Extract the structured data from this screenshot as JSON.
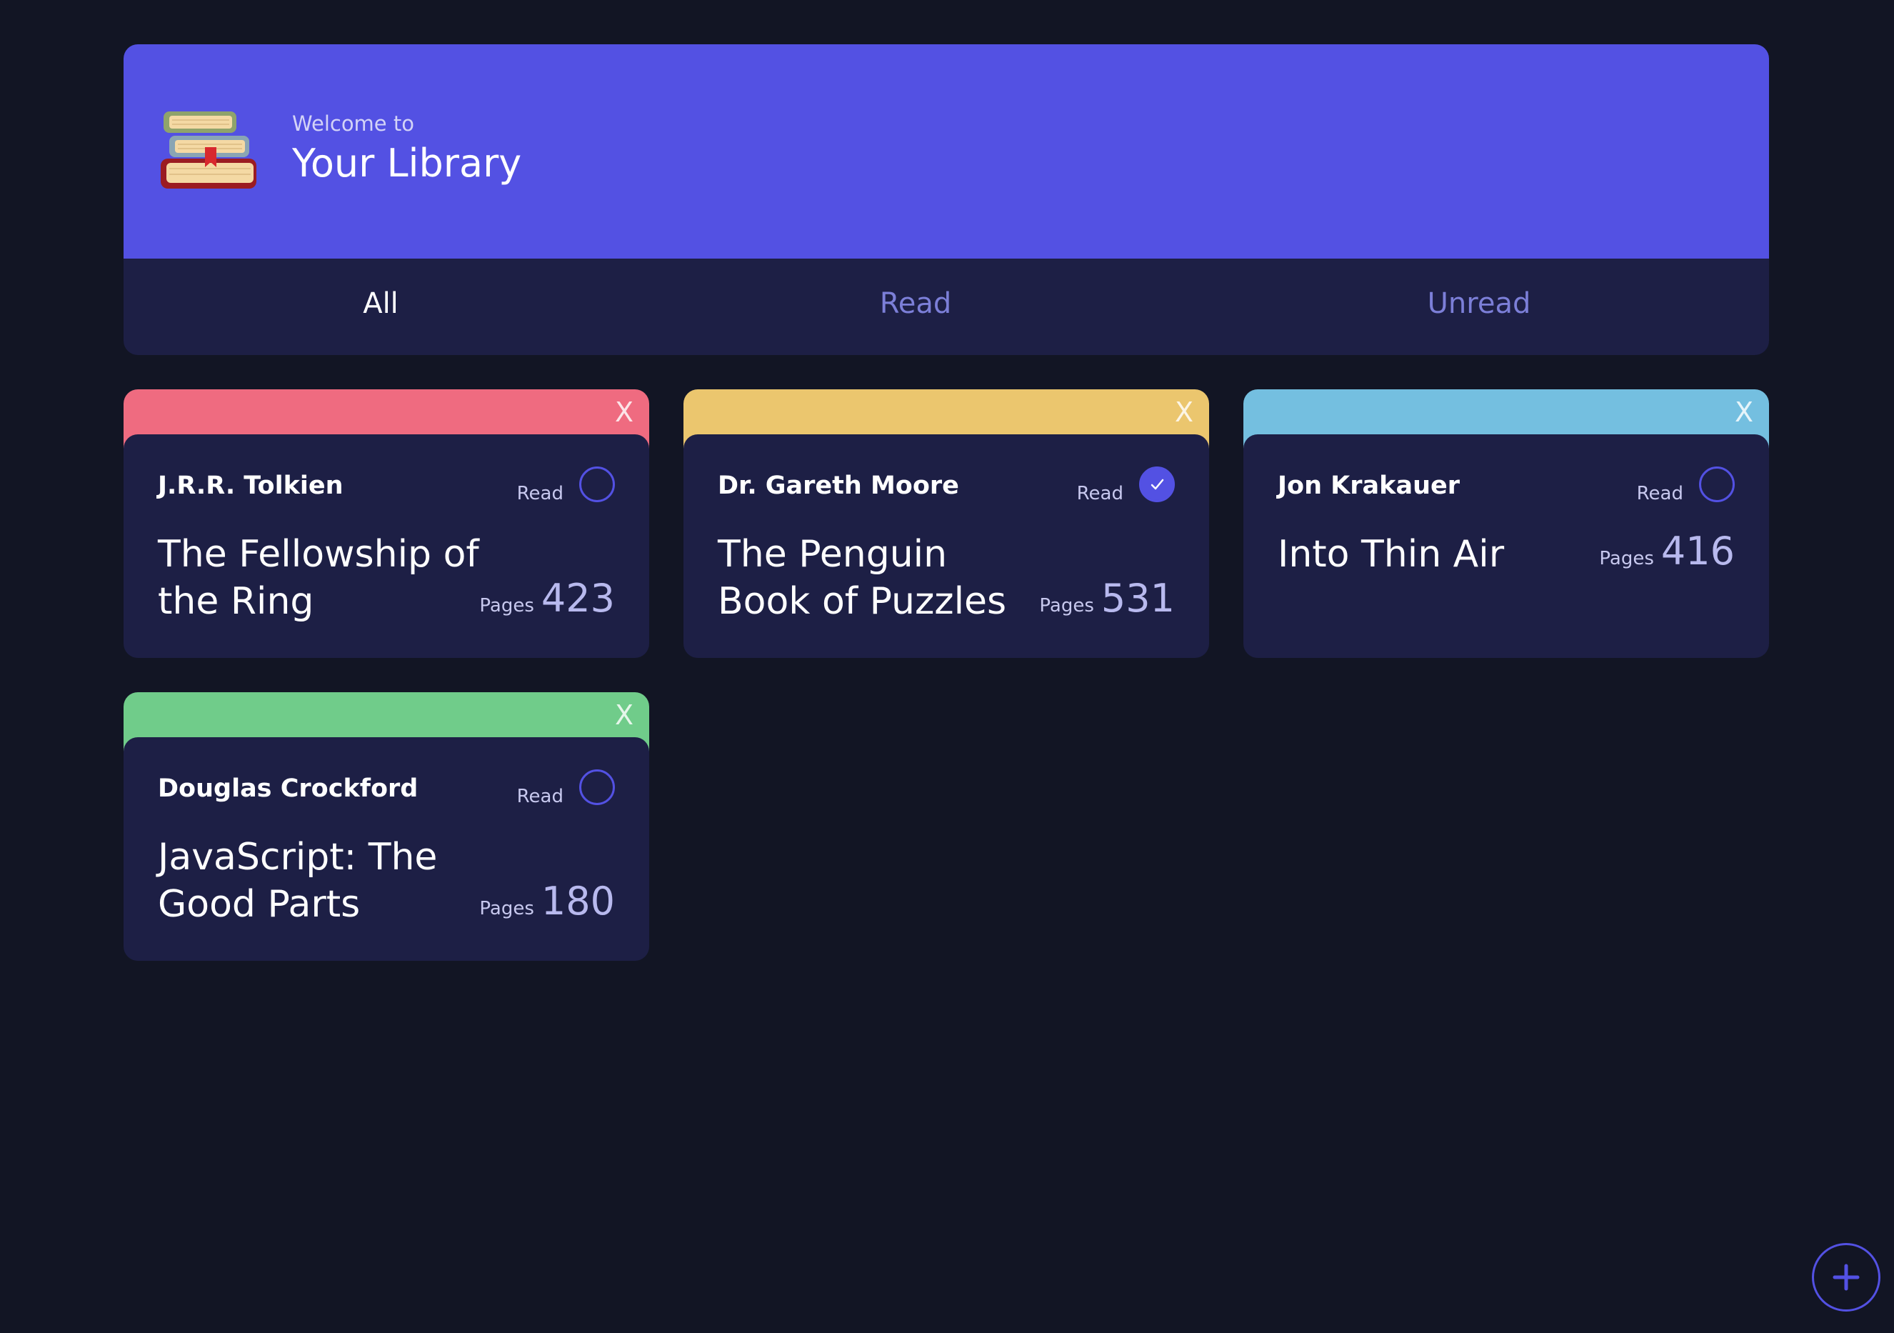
{
  "header": {
    "welcome_text": "Welcome to",
    "title": "Your Library",
    "logo_icon": "books-stack-icon",
    "background_color": "#5351e3"
  },
  "tabs": [
    {
      "label": "All",
      "active": true
    },
    {
      "label": "Read",
      "active": false
    },
    {
      "label": "Unread",
      "active": false
    }
  ],
  "books": [
    {
      "author": "J.R.R. Tolkien",
      "title": "The Fellowship of the Ring",
      "read_label": "Read",
      "read": false,
      "pages_label": "Pages",
      "pages": "423",
      "close_label": "X",
      "accent_color": "#ef6b80"
    },
    {
      "author": "Dr. Gareth Moore",
      "title": "The Penguin Book of Puzzles",
      "read_label": "Read",
      "read": true,
      "pages_label": "Pages",
      "pages": "531",
      "close_label": "X",
      "accent_color": "#ebc66e"
    },
    {
      "author": "Jon Krakauer",
      "title": "Into Thin Air",
      "read_label": "Read",
      "read": false,
      "pages_label": "Pages",
      "pages": "416",
      "close_label": "X",
      "accent_color": "#74bfe0"
    },
    {
      "author": "Douglas Crockford",
      "title": "JavaScript: The Good Parts",
      "read_label": "Read",
      "read": false,
      "pages_label": "Pages",
      "pages": "180",
      "close_label": "X",
      "accent_color": "#70cc8a"
    }
  ],
  "add_button": {
    "icon": "plus-icon"
  },
  "colors": {
    "page_background": "#121524",
    "card_background": "#1d1f45",
    "accent": "#5351e3"
  }
}
